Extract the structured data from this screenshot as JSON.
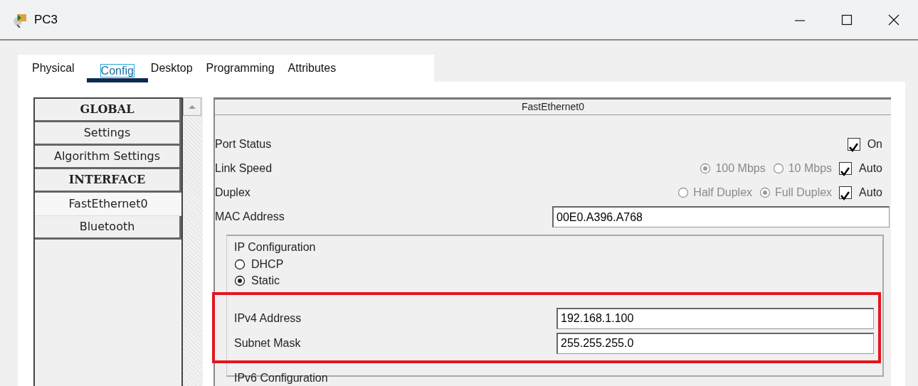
{
  "window": {
    "title": "PC3"
  },
  "tabs": [
    {
      "label": "Physical",
      "selected": false
    },
    {
      "label": "Config",
      "selected": true
    },
    {
      "label": "Desktop",
      "selected": false
    },
    {
      "label": "Programming",
      "selected": false
    },
    {
      "label": "Attributes",
      "selected": false
    }
  ],
  "sidebar": {
    "items": [
      {
        "label": "GLOBAL",
        "kind": "header",
        "selected": false
      },
      {
        "label": "Settings",
        "kind": "item",
        "selected": false
      },
      {
        "label": "Algorithm Settings",
        "kind": "item",
        "selected": false
      },
      {
        "label": "INTERFACE",
        "kind": "header",
        "selected": false
      },
      {
        "label": "FastEthernet0",
        "kind": "item",
        "selected": true
      },
      {
        "label": "Bluetooth",
        "kind": "item",
        "selected": false
      }
    ]
  },
  "panel": {
    "title": "FastEthernet0",
    "port_status": {
      "label": "Port Status",
      "toggle": {
        "label": "On",
        "checked": true
      }
    },
    "link_speed": {
      "label": "Link Speed",
      "options": [
        {
          "label": "100 Mbps",
          "selected": true,
          "disabled": true
        },
        {
          "label": "10 Mbps",
          "selected": false,
          "disabled": true
        }
      ],
      "auto": {
        "label": "Auto",
        "checked": true
      }
    },
    "duplex": {
      "label": "Duplex",
      "options": [
        {
          "label": "Half Duplex",
          "selected": false,
          "disabled": true
        },
        {
          "label": "Full Duplex",
          "selected": true,
          "disabled": true
        }
      ],
      "auto": {
        "label": "Auto",
        "checked": true
      }
    },
    "mac_address": {
      "label": "MAC Address",
      "value": "00E0.A396.A768"
    },
    "ip_configuration": {
      "title": "IP Configuration",
      "modes": [
        {
          "label": "DHCP",
          "selected": false
        },
        {
          "label": "Static",
          "selected": true
        }
      ],
      "fields": [
        {
          "label": "IPv4 Address",
          "value": "192.168.1.100"
        },
        {
          "label": "Subnet Mask",
          "value": "255.255.255.0"
        }
      ]
    },
    "ipv6_configuration": {
      "title": "IPv6 Configuration"
    }
  }
}
